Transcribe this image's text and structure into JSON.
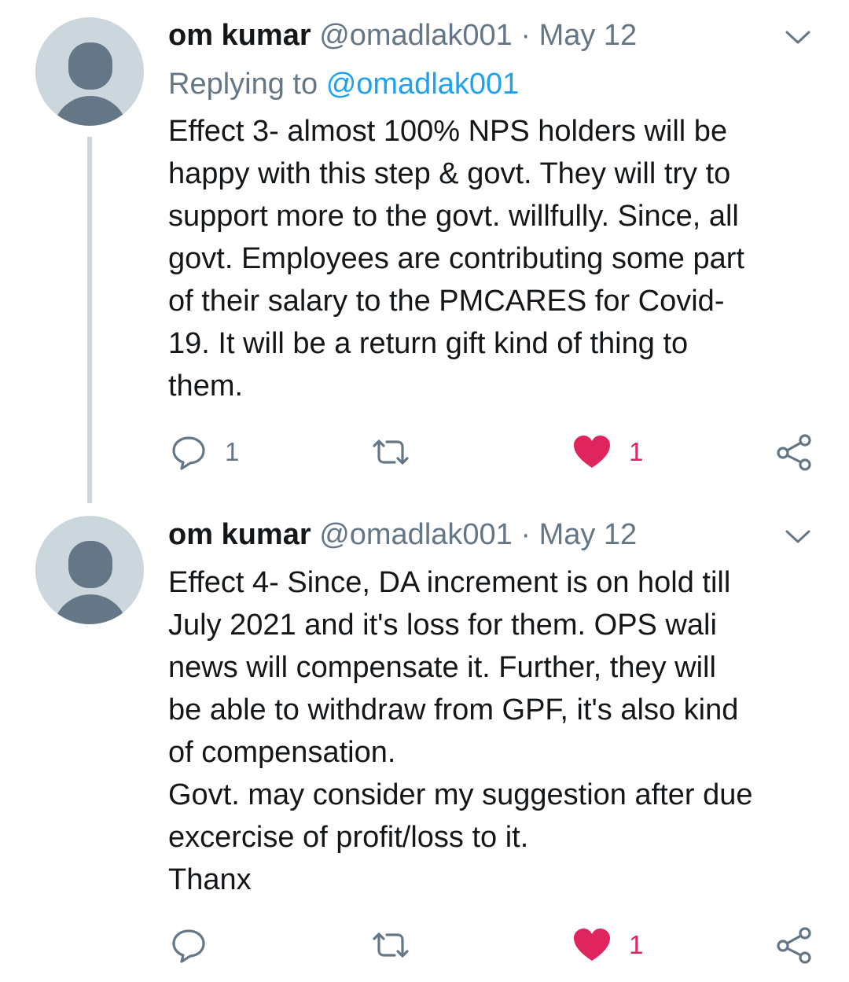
{
  "tweets": [
    {
      "name": "om kumar",
      "handle": "@omadlak001",
      "separator": "·",
      "date": "May 12",
      "replying_prefix": "Replying to",
      "replying_to": "@omadlak001",
      "text": "Effect 3- almost 100% NPS holders will be\nhappy with this step & govt. They will try to\nsupport more to the govt. willfully. Since, all\ngovt. Employees are contributing some part\nof their salary to the PMCARES for Covid-\n19. It will be a return gift kind of thing to\nthem.",
      "reply_count": "1",
      "retweet_count": "",
      "like_count": "1",
      "liked": true
    },
    {
      "name": "om kumar",
      "handle": "@omadlak001",
      "separator": "·",
      "date": "May 12",
      "text": "Effect 4- Since, DA increment is on hold till\nJuly 2021 and it's loss for them. OPS wali\nnews will compensate it. Further, they will\nbe able to withdraw from GPF, it's also kind\nof compensation.\nGovt. may consider my suggestion after due\nexcercise of profit/loss to it.\nThanx",
      "reply_count": "",
      "retweet_count": "",
      "like_count": "1",
      "liked": true
    }
  ],
  "icons": {
    "reply": "reply-icon",
    "retweet": "retweet-icon",
    "like": "heart-icon",
    "share": "share-icon",
    "menu": "chevron-down-icon",
    "avatar": "default-avatar-icon"
  },
  "colors": {
    "text": "#14171a",
    "secondary": "#657786",
    "link": "#1da1f2",
    "like": "#e0245e",
    "avatar_bg": "#ccd6dd"
  }
}
